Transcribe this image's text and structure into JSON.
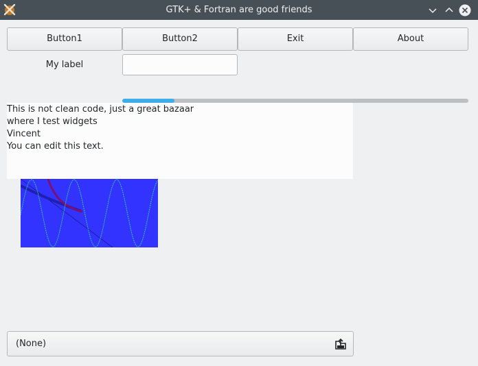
{
  "window": {
    "title": "GTK+ & Fortran are good friends"
  },
  "toolbar": {
    "button1_label": "Button1",
    "button2_label": "Button2",
    "exit_label": "Exit",
    "about_label": "About"
  },
  "form": {
    "label": "My label",
    "entry_value": ""
  },
  "progress": {
    "fraction": 0.15
  },
  "textview": {
    "lines": [
      "This is not clean code, just a great bazaar",
      "where I test widgets",
      "Vincent",
      "You can edit this text."
    ]
  },
  "filechooser": {
    "value": "(None)",
    "icon": "open-file-icon"
  },
  "colors": {
    "titlebar": "#475057",
    "accent": "#3daee9",
    "drawing_background": "#3333ff",
    "wave": "#2ec4a0"
  }
}
